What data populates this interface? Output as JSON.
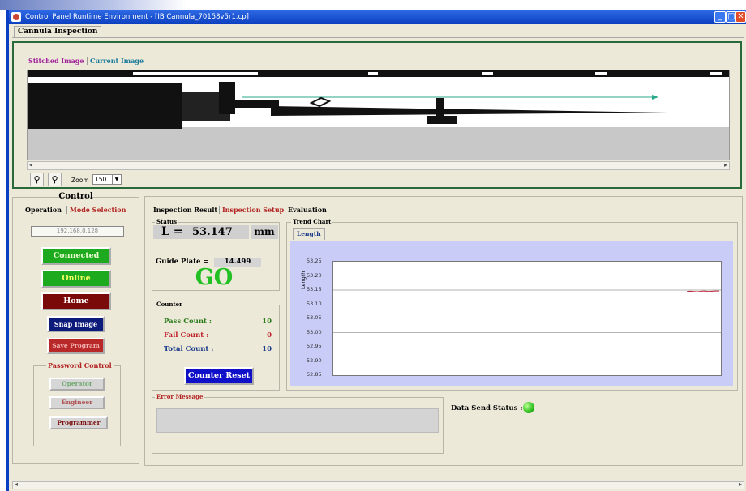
{
  "window": {
    "title": "Control Panel Runtime Environment - [IB Cannula_70158v5r1.cp]",
    "controls": {
      "minimize": "_",
      "maximize": "□",
      "close": "✕"
    }
  },
  "main_tab": "Cannula Inspection",
  "image_panel": {
    "tabs": [
      "Stitched Image",
      "Current Image"
    ],
    "zoom_label": "Zoom",
    "zoom_value": "150"
  },
  "control": {
    "title": "Control",
    "tabs": [
      "Operation",
      "Mode Selection"
    ],
    "ip_address": "192.168.0.128",
    "buttons": {
      "connected": "Connected",
      "online": "Online",
      "home": "Home",
      "snap_image": "Snap Image",
      "save_program": "Save Program"
    },
    "password_control": {
      "title": "Password Control",
      "operator": "Operator",
      "engineer": "Engineer",
      "programmer": "Programmer"
    }
  },
  "inspection": {
    "tabs": [
      "Inspection Result",
      "Inspection Setup",
      "Evaluation"
    ],
    "status": {
      "title": "Status",
      "length_label": "L =",
      "length_value": "53.147",
      "length_unit": "mm",
      "guide_plate_label": "Guide Plate =",
      "guide_plate_value": "14.499",
      "result": "GO"
    },
    "counter": {
      "title": "Counter",
      "pass_label": "Pass Count :",
      "pass_value": "10",
      "fail_label": "Fail Count :",
      "fail_value": "0",
      "total_label": "Total Count :",
      "total_value": "10",
      "reset_button": "Counter Reset"
    },
    "error": {
      "title": "Error Message",
      "message": ""
    },
    "data_send_status": {
      "label": "Data Send Status :",
      "color": "#2fbf1f"
    }
  },
  "trend_chart": {
    "title": "Trend Chart",
    "tab": "Length",
    "ylabel": "Length"
  },
  "chart_data": {
    "type": "line",
    "ylabel": "Length",
    "ylim": [
      52.85,
      53.25
    ],
    "y_ticks": [
      "53.25",
      "53.20",
      "53.15",
      "53.10",
      "53.05",
      "53.00",
      "52.95",
      "52.90",
      "52.85"
    ],
    "reference_lines": [
      53.15,
      53.0
    ],
    "series": [
      {
        "values": [
          53.145,
          53.146,
          53.145,
          53.144,
          53.146,
          53.147,
          53.145,
          53.146,
          53.147,
          53.147
        ],
        "color": "#c0283c"
      }
    ]
  },
  "colors": {
    "accent_green": "#1eaa1e",
    "home_maroon": "#7a0a0a",
    "snap_navy": "#0c1a7a",
    "go_green": "#22c022",
    "frame_green": "#2a6a3a"
  }
}
